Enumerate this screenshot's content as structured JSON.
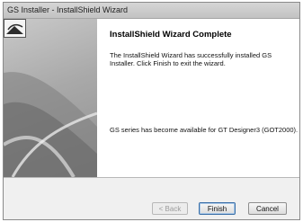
{
  "window": {
    "title": "GS Installer - InstallShield Wizard"
  },
  "wizard": {
    "heading": "InstallShield Wizard Complete",
    "message": "The InstallShield Wizard has successfully installed GS Installer. Click Finish to exit the wizard.",
    "info": "GS series has become available for GT Designer3 (GOT2000)."
  },
  "buttons": {
    "back_label": "< Back",
    "finish_label": "Finish",
    "cancel_label": "Cancel"
  },
  "icons": {
    "side_logo": "installshield-logo-icon"
  }
}
